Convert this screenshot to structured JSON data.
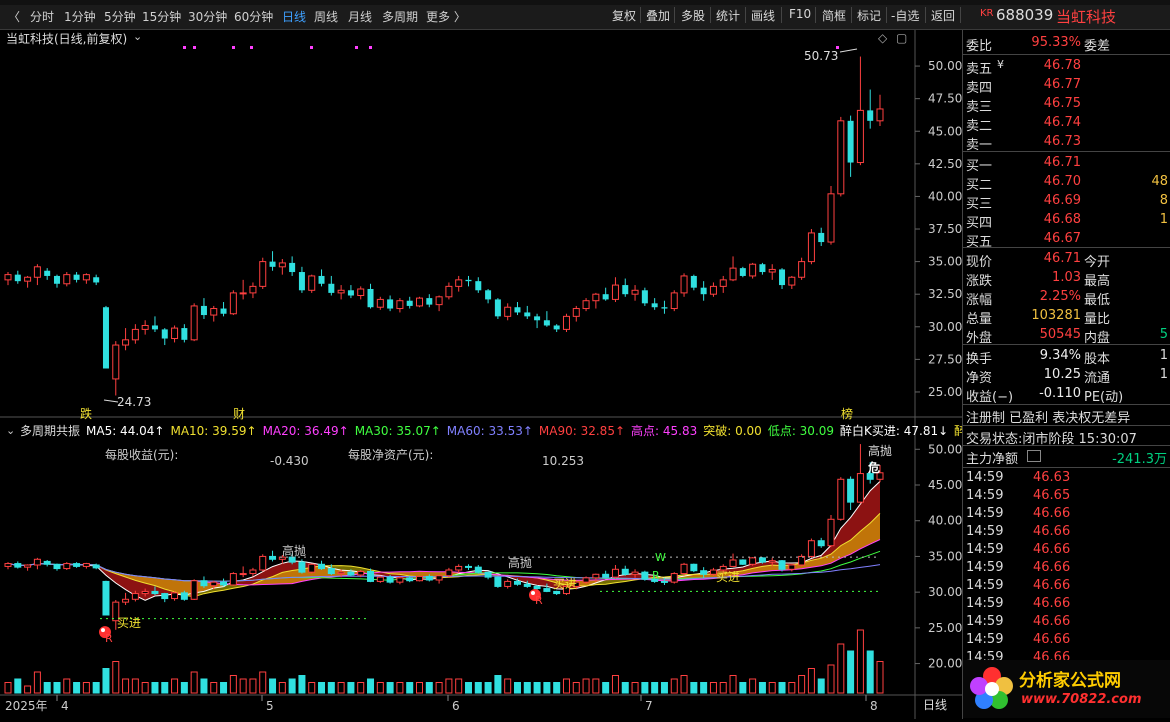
{
  "toolbar": {
    "periods": [
      "分时",
      "1分钟",
      "5分钟",
      "15分钟",
      "30分钟",
      "60分钟",
      "日线",
      "周线",
      "月线",
      "多周期",
      "更多 〉"
    ],
    "active_period": "日线",
    "right_buttons": [
      "复权",
      "叠加",
      "多股",
      "统计",
      "画线",
      "F10",
      "简框",
      "标记",
      "-自选",
      "返回"
    ]
  },
  "stock": {
    "badge": "KR",
    "code": "688039",
    "name": "当虹科技"
  },
  "main_chart": {
    "title": "当虹科技(日线,前复权)",
    "high_label": "50.73",
    "low_label": "24.73",
    "markers": [
      "跌",
      "财",
      "榜"
    ],
    "price_axis": [
      "50.00",
      "47.50",
      "45.00",
      "42.50",
      "40.00",
      "37.50",
      "35.00",
      "32.50",
      "30.00",
      "27.50",
      "25.00"
    ]
  },
  "indicator_bar": {
    "name": "多周期共振",
    "items": [
      {
        "text": "MA5: 44.04↑",
        "color": "#ffffff"
      },
      {
        "text": "MA10: 39.59↑",
        "color": "#f0e030"
      },
      {
        "text": "MA20: 36.49↑",
        "color": "#ff40ff"
      },
      {
        "text": "MA30: 35.07↑",
        "color": "#40ff40"
      },
      {
        "text": "MA60: 33.53↑",
        "color": "#8080ff"
      },
      {
        "text": "MA90: 32.85↑",
        "color": "#ff4040"
      },
      {
        "text": "高点: 45.83",
        "color": "#ff40ff"
      },
      {
        "text": "突破: 0.00",
        "color": "#f0e030"
      },
      {
        "text": "低点: 30.09",
        "color": "#40ff40"
      },
      {
        "text": "醉白K买进: 47.81↓",
        "color": "#ffffff"
      },
      {
        "text": "醉",
        "color": "#f0e030"
      }
    ]
  },
  "lower_chart": {
    "eps_label": "每股收益(元):",
    "eps_value": "-0.430",
    "nav_label": "每股净资产(元):",
    "nav_value": "10.253",
    "price_axis": [
      "50.00",
      "45.00",
      "40.00",
      "35.00",
      "30.00",
      "25.00",
      "20.00"
    ],
    "annotations": {
      "high_throw": "高抛",
      "buy_in": "买进",
      "r": "R",
      "w": "W",
      "danger": "危"
    }
  },
  "date_axis": {
    "labels": [
      "2025年",
      "4",
      "5",
      "6",
      "7",
      "8"
    ],
    "period": "日线"
  },
  "quote": {
    "weibi_label": "委比",
    "weibi": "95.33%",
    "weicha_label": "委差",
    "asks": [
      {
        "label": "卖五",
        "price": "46.78",
        "vol": ""
      },
      {
        "label": "卖四",
        "price": "46.77",
        "vol": ""
      },
      {
        "label": "卖三",
        "price": "46.75",
        "vol": ""
      },
      {
        "label": "卖二",
        "price": "46.74",
        "vol": ""
      },
      {
        "label": "卖一",
        "price": "46.73",
        "vol": ""
      }
    ],
    "bids": [
      {
        "label": "买一",
        "price": "46.71",
        "vol": ""
      },
      {
        "label": "买二",
        "price": "46.70",
        "vol": "48"
      },
      {
        "label": "买三",
        "price": "46.69",
        "vol": "8"
      },
      {
        "label": "买四",
        "price": "46.68",
        "vol": "1"
      },
      {
        "label": "买五",
        "price": "46.67",
        "vol": ""
      }
    ],
    "stats": [
      {
        "l1": "现价",
        "v1": "46.71",
        "c1": "red",
        "l2": "今开",
        "v2": ""
      },
      {
        "l1": "涨跌",
        "v1": "1.03",
        "c1": "red",
        "l2": "最高",
        "v2": ""
      },
      {
        "l1": "涨幅",
        "v1": "2.25%",
        "c1": "red",
        "l2": "最低",
        "v2": ""
      },
      {
        "l1": "总量",
        "v1": "103281",
        "c1": "yellow",
        "l2": "量比",
        "v2": ""
      },
      {
        "l1": "外盘",
        "v1": "50545",
        "c1": "red",
        "l2": "内盘",
        "v2": "5"
      }
    ],
    "stats2": [
      {
        "l1": "换手",
        "v1": "9.34%",
        "l2": "股本",
        "v2": "1"
      },
      {
        "l1": "净资",
        "v1": "10.25",
        "l2": "流通",
        "v2": "1"
      },
      {
        "l1": "收益(−)",
        "v1": "-0.110",
        "l2": "PE(动)",
        "v2": ""
      }
    ],
    "tags": "注册制 已盈利 表决权无差异",
    "status_label": "交易状态:",
    "status": "闭市阶段 15:30:07",
    "net_label": "主力净额",
    "net_value": "-241.3万",
    "ticks": [
      {
        "t": "14:59",
        "p": "46.63"
      },
      {
        "t": "14:59",
        "p": "46.65"
      },
      {
        "t": "14:59",
        "p": "46.66"
      },
      {
        "t": "14:59",
        "p": "46.66"
      },
      {
        "t": "14:59",
        "p": "46.66"
      },
      {
        "t": "14:59",
        "p": "46.66"
      },
      {
        "t": "14:59",
        "p": "46.66"
      },
      {
        "t": "14:59",
        "p": "46.66"
      },
      {
        "t": "14:59",
        "p": "46.66"
      },
      {
        "t": "14:59",
        "p": "46.66"
      },
      {
        "t": "14:59",
        "p": "46.66"
      }
    ]
  },
  "watermark": {
    "name": "分析家公式网",
    "url": "www.70822.com"
  },
  "chart_data": {
    "type": "candlestick",
    "title": "当虹科技(日线,前复权)",
    "ylim": [
      24,
      52
    ],
    "candles": [
      [
        33.6,
        34.2,
        33.2,
        34.0
      ],
      [
        34.0,
        34.3,
        33.3,
        33.5
      ],
      [
        33.5,
        33.9,
        33.0,
        33.8
      ],
      [
        33.8,
        34.8,
        33.2,
        34.6
      ],
      [
        34.3,
        34.5,
        33.6,
        33.9
      ],
      [
        33.9,
        34.0,
        33.0,
        33.3
      ],
      [
        33.3,
        34.2,
        33.1,
        34.0
      ],
      [
        34.0,
        34.2,
        33.4,
        33.6
      ],
      [
        33.6,
        34.1,
        33.3,
        34.0
      ],
      [
        33.8,
        34.0,
        33.2,
        33.4
      ],
      [
        31.5,
        31.6,
        26.8,
        26.8
      ],
      [
        26.0,
        28.9,
        24.73,
        28.6
      ],
      [
        28.6,
        29.9,
        28.2,
        29.0
      ],
      [
        29.0,
        30.2,
        28.7,
        29.8
      ],
      [
        29.8,
        30.5,
        29.4,
        30.1
      ],
      [
        30.1,
        30.8,
        29.6,
        29.8
      ],
      [
        29.8,
        29.9,
        28.6,
        29.1
      ],
      [
        29.1,
        30.1,
        28.8,
        29.9
      ],
      [
        29.9,
        30.2,
        28.8,
        29.0
      ],
      [
        29.0,
        31.8,
        28.9,
        31.6
      ],
      [
        31.6,
        32.2,
        30.6,
        30.9
      ],
      [
        30.9,
        31.6,
        30.4,
        31.4
      ],
      [
        31.4,
        31.9,
        30.8,
        31.0
      ],
      [
        31.0,
        32.8,
        30.9,
        32.6
      ],
      [
        32.6,
        33.6,
        32.1,
        32.6
      ],
      [
        32.6,
        33.4,
        32.2,
        33.1
      ],
      [
        33.1,
        35.3,
        32.9,
        35.0
      ],
      [
        35.0,
        35.8,
        34.3,
        34.6
      ],
      [
        34.6,
        35.2,
        34.0,
        34.9
      ],
      [
        34.9,
        35.4,
        33.9,
        34.2
      ],
      [
        34.2,
        34.6,
        32.6,
        32.8
      ],
      [
        32.8,
        34.0,
        32.6,
        33.9
      ],
      [
        33.9,
        34.4,
        33.1,
        33.3
      ],
      [
        33.3,
        33.9,
        32.4,
        32.6
      ],
      [
        32.6,
        33.2,
        32.1,
        32.8
      ],
      [
        32.8,
        33.2,
        32.2,
        32.4
      ],
      [
        32.4,
        33.1,
        32.1,
        32.9
      ],
      [
        32.9,
        33.3,
        31.4,
        31.5
      ],
      [
        31.5,
        32.3,
        31.3,
        32.1
      ],
      [
        32.1,
        32.4,
        31.2,
        31.4
      ],
      [
        31.4,
        32.2,
        31.1,
        32.0
      ],
      [
        32.0,
        32.3,
        31.4,
        31.6
      ],
      [
        31.6,
        32.3,
        31.5,
        32.2
      ],
      [
        32.2,
        32.5,
        31.5,
        31.7
      ],
      [
        31.7,
        32.4,
        31.2,
        32.3
      ],
      [
        32.3,
        33.4,
        32.1,
        33.1
      ],
      [
        33.1,
        33.9,
        32.7,
        33.6
      ],
      [
        33.6,
        33.9,
        33.1,
        33.5
      ],
      [
        33.5,
        33.8,
        32.6,
        32.8
      ],
      [
        32.8,
        32.9,
        31.8,
        32.1
      ],
      [
        32.1,
        32.2,
        30.6,
        30.8
      ],
      [
        30.8,
        31.8,
        30.5,
        31.5
      ],
      [
        31.5,
        31.9,
        30.9,
        31.1
      ],
      [
        31.1,
        31.6,
        30.6,
        30.8
      ],
      [
        30.8,
        31.0,
        29.9,
        30.5
      ],
      [
        30.5,
        31.2,
        30.0,
        30.1
      ],
      [
        30.1,
        30.2,
        29.6,
        29.8
      ],
      [
        29.8,
        31.0,
        29.6,
        30.8
      ],
      [
        30.8,
        31.6,
        30.4,
        31.4
      ],
      [
        31.4,
        32.2,
        31.2,
        32.0
      ],
      [
        32.0,
        32.6,
        31.4,
        32.5
      ],
      [
        32.5,
        33.0,
        32.0,
        32.1
      ],
      [
        32.1,
        33.8,
        31.9,
        33.2
      ],
      [
        33.2,
        33.7,
        32.3,
        32.5
      ],
      [
        32.5,
        33.2,
        32.0,
        32.8
      ],
      [
        32.8,
        33.0,
        31.6,
        31.8
      ],
      [
        31.8,
        32.2,
        31.3,
        31.5
      ],
      [
        31.5,
        32.0,
        31.0,
        31.4
      ],
      [
        31.4,
        32.8,
        31.2,
        32.6
      ],
      [
        32.6,
        34.1,
        32.3,
        33.9
      ],
      [
        33.9,
        34.0,
        32.8,
        33.0
      ],
      [
        33.0,
        33.5,
        32.0,
        32.5
      ],
      [
        32.5,
        33.4,
        32.3,
        33.1
      ],
      [
        33.1,
        33.9,
        32.6,
        33.6
      ],
      [
        33.6,
        35.4,
        33.5,
        34.5
      ],
      [
        34.5,
        34.6,
        33.8,
        33.9
      ],
      [
        33.9,
        34.9,
        33.7,
        34.8
      ],
      [
        34.8,
        34.9,
        34.0,
        34.2
      ],
      [
        34.2,
        34.8,
        33.6,
        34.4
      ],
      [
        34.4,
        34.5,
        32.9,
        33.2
      ],
      [
        33.2,
        33.9,
        32.9,
        33.8
      ],
      [
        33.8,
        35.3,
        33.6,
        35.0
      ],
      [
        35.0,
        37.5,
        34.8,
        37.2
      ],
      [
        37.2,
        37.6,
        36.2,
        36.5
      ],
      [
        36.5,
        40.8,
        36.3,
        40.2
      ],
      [
        40.2,
        46.1,
        40.0,
        45.8
      ],
      [
        45.8,
        46.2,
        41.5,
        42.6
      ],
      [
        42.6,
        50.73,
        42.4,
        46.6
      ],
      [
        46.6,
        48.2,
        45.2,
        45.8
      ],
      [
        45.8,
        47.8,
        45.4,
        46.71
      ]
    ],
    "volume_axis_top": "",
    "date_labels": [
      "4",
      "5",
      "6",
      "7",
      "8"
    ]
  }
}
